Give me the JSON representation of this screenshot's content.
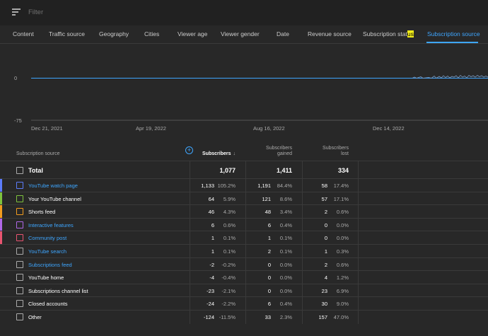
{
  "filter": {
    "placeholder": "Filter"
  },
  "tabs": [
    {
      "label": "Content"
    },
    {
      "label": "Traffic source"
    },
    {
      "label": "Geography"
    },
    {
      "label": "Cities"
    },
    {
      "label": "Viewer age"
    },
    {
      "label": "Viewer gender"
    },
    {
      "label": "Date"
    },
    {
      "label": "Revenue source"
    },
    {
      "label_pre": "Subscription stat",
      "label_hl": "us"
    },
    {
      "label": "Subscription source"
    }
  ],
  "chart": {
    "y_ticks": [
      "0",
      "-75"
    ],
    "x_ticks": [
      "Dec 21, 2021",
      "Apr 19, 2022",
      "Aug 16, 2022",
      "Dec 14, 2022"
    ],
    "line_color": "#3ea6ff"
  },
  "table": {
    "headers": {
      "source": "Subscription source",
      "subscribers": "Subscribers",
      "gained_l1": "Subscribers",
      "gained_l2": "gained",
      "lost_l1": "Subscribers",
      "lost_l2": "lost"
    },
    "total": {
      "label": "Total",
      "subscribers": "1,077",
      "gained": "1,411",
      "lost": "334"
    },
    "rows": [
      {
        "label": "YouTube watch page",
        "link": true,
        "color": "#5c7cfa",
        "sub": "1,133",
        "sub_pct": "105.2%",
        "gained": "1,191",
        "gained_pct": "84.4%",
        "lost": "58",
        "lost_pct": "17.4%"
      },
      {
        "label": "Your YouTube channel",
        "link": false,
        "color": "#7ec23d",
        "sub": "64",
        "sub_pct": "5.9%",
        "gained": "121",
        "gained_pct": "8.6%",
        "lost": "57",
        "lost_pct": "17.1%"
      },
      {
        "label": "Shorts feed",
        "link": false,
        "color": "#f29c1f",
        "sub": "46",
        "sub_pct": "4.3%",
        "gained": "48",
        "gained_pct": "3.4%",
        "lost": "2",
        "lost_pct": "0.6%"
      },
      {
        "label": "Interactive features",
        "link": true,
        "color": "#b068e8",
        "sub": "6",
        "sub_pct": "0.6%",
        "gained": "6",
        "gained_pct": "0.4%",
        "lost": "0",
        "lost_pct": "0.0%"
      },
      {
        "label": "Community post",
        "link": true,
        "color": "#e85470",
        "sub": "1",
        "sub_pct": "0.1%",
        "gained": "1",
        "gained_pct": "0.1%",
        "lost": "0",
        "lost_pct": "0.0%"
      },
      {
        "label": "YouTube search",
        "link": true,
        "color": "",
        "sub": "1",
        "sub_pct": "0.1%",
        "gained": "2",
        "gained_pct": "0.1%",
        "lost": "1",
        "lost_pct": "0.3%"
      },
      {
        "label": "Subscriptions feed",
        "link": true,
        "color": "",
        "sub": "-2",
        "sub_pct": "-0.2%",
        "gained": "0",
        "gained_pct": "0.0%",
        "lost": "2",
        "lost_pct": "0.6%"
      },
      {
        "label": "YouTube home",
        "link": false,
        "color": "",
        "sub": "-4",
        "sub_pct": "-0.4%",
        "gained": "0",
        "gained_pct": "0.0%",
        "lost": "4",
        "lost_pct": "1.2%"
      },
      {
        "label": "Subscriptions channel list",
        "link": false,
        "color": "",
        "sub": "-23",
        "sub_pct": "-2.1%",
        "gained": "0",
        "gained_pct": "0.0%",
        "lost": "23",
        "lost_pct": "6.9%"
      },
      {
        "label": "Closed accounts",
        "link": false,
        "color": "",
        "sub": "-24",
        "sub_pct": "-2.2%",
        "gained": "6",
        "gained_pct": "0.4%",
        "lost": "30",
        "lost_pct": "9.0%"
      },
      {
        "label": "Other",
        "link": false,
        "color": "",
        "sub": "-124",
        "sub_pct": "-11.5%",
        "gained": "33",
        "gained_pct": "2.3%",
        "lost": "157",
        "lost_pct": "47.0%"
      }
    ]
  }
}
